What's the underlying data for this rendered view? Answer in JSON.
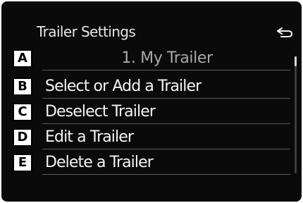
{
  "header": {
    "title": "Trailer Settings",
    "back_icon": "back-arrow-icon"
  },
  "menu": {
    "current_trailer": "1. My Trailer",
    "items": [
      {
        "label": "Select or Add a Trailer"
      },
      {
        "label": "Deselect Trailer"
      },
      {
        "label": "Edit a Trailer"
      },
      {
        "label": "Delete a Trailer"
      }
    ]
  },
  "callouts": [
    "A",
    "B",
    "C",
    "D",
    "E"
  ],
  "colors": {
    "background": "#0a0a0a",
    "text": "#f4f4f4",
    "muted_text": "#a8a8a8",
    "divider": "#5a5a5a"
  }
}
